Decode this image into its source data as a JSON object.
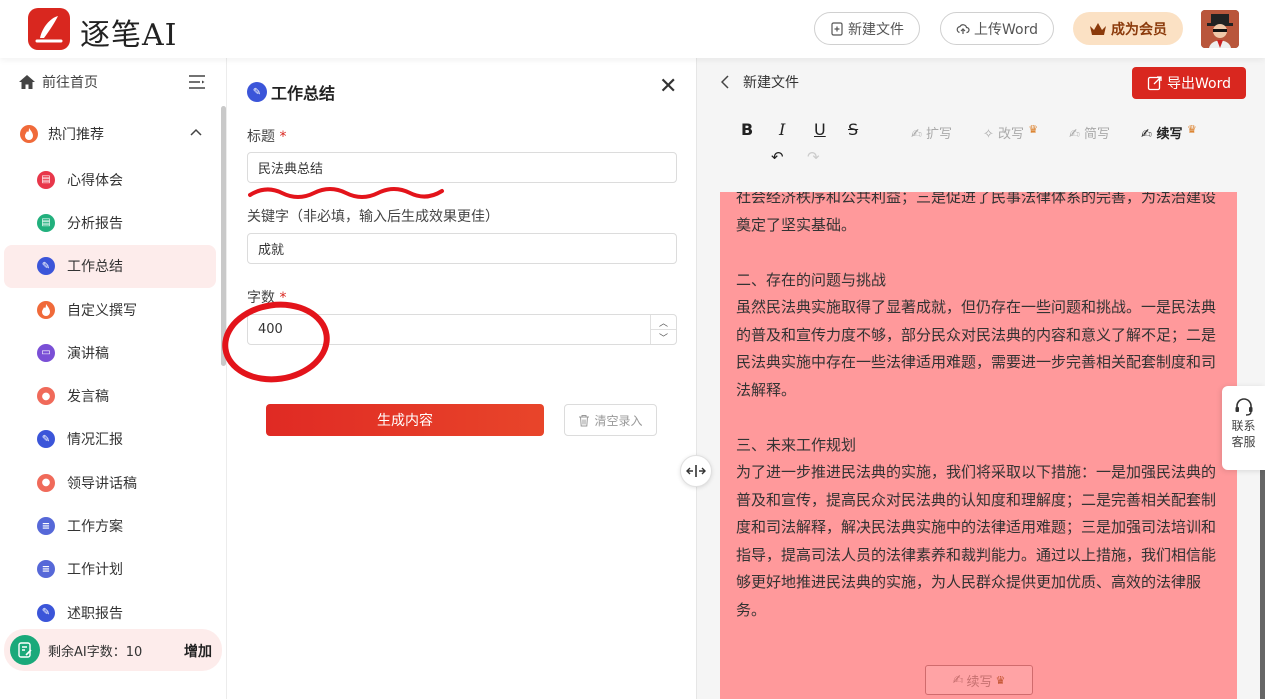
{
  "header": {
    "logo_text": "逐笔AI",
    "new_file": "新建文件",
    "upload_word": "上传Word",
    "member": "成为会员"
  },
  "sidebar": {
    "home": "前往首页",
    "hot": "热门推荐",
    "items": [
      {
        "label": "心得体会",
        "color": "#e8374a",
        "icon": "notebook-icon"
      },
      {
        "label": "分析报告",
        "color": "#22b07d",
        "icon": "report-icon"
      },
      {
        "label": "工作总结",
        "color": "#3b55d9",
        "icon": "pen-doc-icon"
      },
      {
        "label": "自定义撰写",
        "color": "#f06a3a",
        "icon": "flame-icon"
      },
      {
        "label": "演讲稿",
        "color": "#7a4fd6",
        "icon": "podium-icon"
      },
      {
        "label": "发言稿",
        "color": "#f06a5a",
        "icon": "speaker-icon"
      },
      {
        "label": "情况汇报",
        "color": "#3b55d9",
        "icon": "pen-doc-icon"
      },
      {
        "label": "领导讲话稿",
        "color": "#f06a5a",
        "icon": "speaker-icon"
      },
      {
        "label": "工作方案",
        "color": "#5668d8",
        "icon": "plan-icon"
      },
      {
        "label": "工作计划",
        "color": "#5668d8",
        "icon": "plan-icon"
      },
      {
        "label": "述职报告",
        "color": "#3b55d9",
        "icon": "pen-doc-icon"
      }
    ],
    "remaining": "剩余AI字数：10",
    "add": "增加"
  },
  "form": {
    "title": "工作总结",
    "title_label": "标题",
    "title_value": "民法典总结",
    "keywords_label": "关键字（非必填，输入后生成效果更佳）",
    "keywords_value": "成就",
    "count_label": "字数",
    "count_value": "400",
    "required_mark": "*",
    "generate": "生成内容",
    "clear": "清空录入"
  },
  "editor": {
    "back_title": "新建文件",
    "export": "导出Word",
    "toolbar": {
      "bold": "B",
      "italic": "I",
      "underline": "U",
      "strike": "S",
      "expand": "扩写",
      "rewrite": "改写",
      "simplify": "简写",
      "continue": "续写"
    },
    "paragraphs": [
      "社会经济秩序和公共利益；三是促进了民事法律体系的完善，为法治建设奠定了坚实基础。",
      "",
      "二、存在的问题与挑战",
      "虽然民法典实施取得了显著成就，但仍存在一些问题和挑战。一是民法典的普及和宣传力度不够，部分民众对民法典的内容和意义了解不足；二是民法典实施中存在一些法律适用难题，需要进一步完善相关配套制度和司法解释。",
      "",
      "三、未来工作规划",
      "为了进一步推进民法典的实施，我们将采取以下措施：一是加强民法典的普及和宣传，提高民众对民法典的认知度和理解度；二是完善相关配套制度和司法解释，解决民法典实施中的法律适用难题；三是加强司法培训和指导，提高司法人员的法律素养和裁判能力。通过以上措施，我们相信能够更好地推进民法典的实施，为人民群众提供更加优质、高效的法律服务。"
    ],
    "continue_bottom": "续写"
  },
  "service": {
    "line1": "联系",
    "line2": "客服"
  },
  "colors": {
    "brand_red": "#d9271f",
    "highlight": "#ff999b",
    "member_bg": "#fbe1c4"
  }
}
